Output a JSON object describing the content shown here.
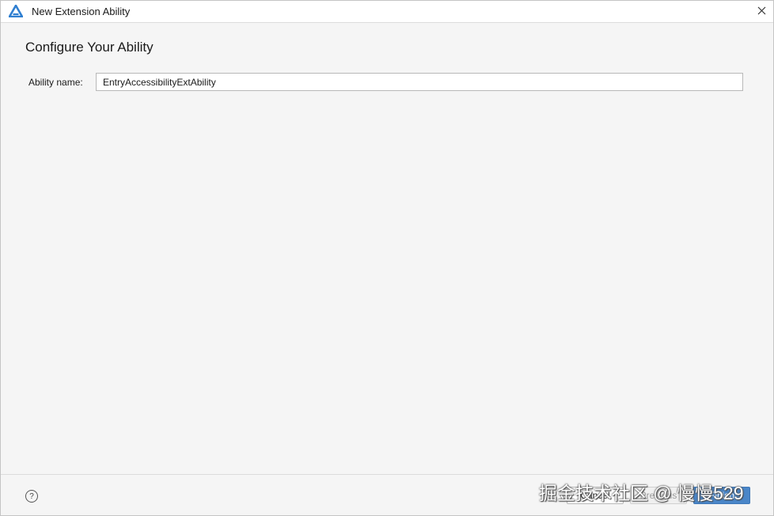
{
  "window": {
    "title": "New Extension Ability",
    "close_glyph": "✕"
  },
  "page": {
    "title": "Configure Your Ability"
  },
  "form": {
    "ability_name_label": "Ability name:",
    "ability_name_value": "EntryAccessibilityExtAbility"
  },
  "footer": {
    "help_glyph": "?",
    "cancel_label": "Cancel",
    "previous_label": "Previous",
    "finish_label": "Finish"
  },
  "watermark": {
    "text": "掘金技术社区 @ 慢慢529"
  },
  "colors": {
    "accent": "#4a86c8",
    "app_icon": "#2f7fd1",
    "background": "#f5f5f5"
  },
  "icons": {
    "app": "deveco-app-icon",
    "close": "close-icon",
    "help": "help-icon"
  }
}
